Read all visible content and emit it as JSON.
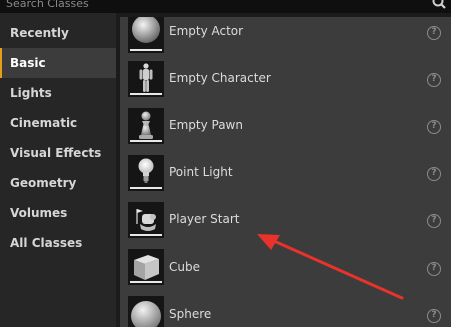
{
  "search": {
    "placeholder": "Search Classes"
  },
  "categories": [
    {
      "label": "Recently Placed"
    },
    {
      "label": "Basic",
      "selected": true
    },
    {
      "label": "Lights"
    },
    {
      "label": "Cinematic"
    },
    {
      "label": "Visual Effects"
    },
    {
      "label": "Geometry"
    },
    {
      "label": "Volumes"
    },
    {
      "label": "All Classes"
    }
  ],
  "items": [
    {
      "label": "Empty Actor",
      "icon": "sphere-icon"
    },
    {
      "label": "Empty Character",
      "icon": "mannequin-icon"
    },
    {
      "label": "Empty Pawn",
      "icon": "pawn-icon"
    },
    {
      "label": "Point Light",
      "icon": "lightbulb-icon"
    },
    {
      "label": "Player Start",
      "icon": "player-start-icon"
    },
    {
      "label": "Cube",
      "icon": "cube-icon"
    },
    {
      "label": "Sphere",
      "icon": "sphere-icon"
    }
  ],
  "help_glyph": "?",
  "colors": {
    "accent": "#e59e1a",
    "annotation_arrow": "#e8322c"
  }
}
